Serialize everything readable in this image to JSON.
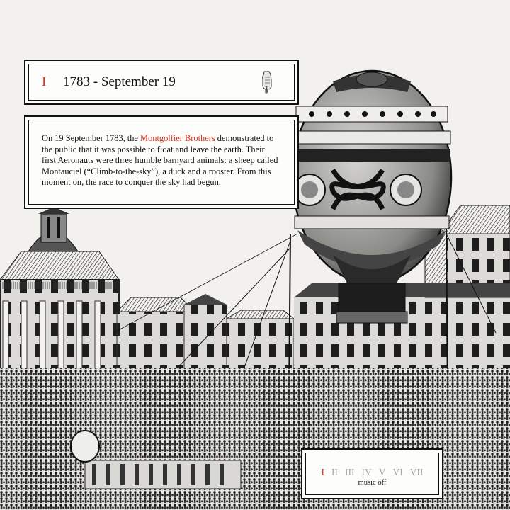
{
  "header": {
    "chapter_numeral": "I",
    "title": "1783 - September 19"
  },
  "story": {
    "before": "On 19 September 1783, the ",
    "link_text": "Montgolfier Brothers",
    "after": " demonstrated to the public that it was possible to float and leave the earth. Their first Aeronauts were three humble barnyard animals: a sheep called Montauciel (“Climb-to-the-sky”), a duck and a rooster. From this moment on, the race to conquer the sky had begun."
  },
  "navigation": {
    "chapters": [
      "I",
      "II",
      "III",
      "IV",
      "V",
      "VI",
      "VII"
    ],
    "active_index": 0,
    "music_label": "music off"
  },
  "colors": {
    "accent": "#d9331c",
    "inactive": "#a8a8a8",
    "ink": "#111111",
    "paper": "#f2f1ee"
  },
  "icons": {
    "pointer": "pointing-hand-icon"
  }
}
